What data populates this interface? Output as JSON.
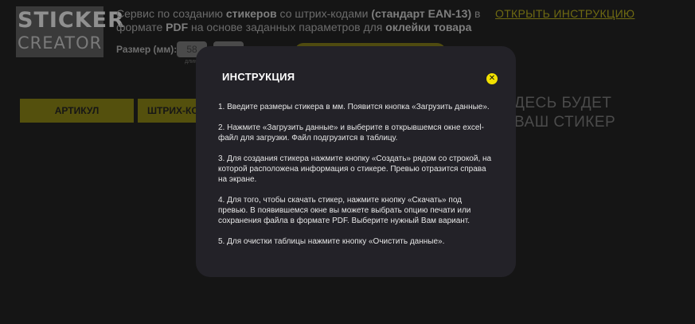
{
  "logo": {
    "line1": "STICKER",
    "line2": "CREATOR"
  },
  "header": {
    "tagline_parts": [
      {
        "text": "Сервис по созданию ",
        "bold": false
      },
      {
        "text": "стикеров",
        "bold": true
      },
      {
        "text": " со штрих-кодами ",
        "bold": false
      },
      {
        "text": "(стандарт EAN-13)",
        "bold": true
      },
      {
        "text": " в формате ",
        "bold": false
      },
      {
        "text": "PDF",
        "bold": true
      },
      {
        "text": " на основе заданных параметров для ",
        "bold": false
      },
      {
        "text": "оклейки товара",
        "bold": true
      }
    ],
    "instruction_link": "ОТКРЫТЬ ИНСТРУКЦИЮ"
  },
  "size": {
    "label": "Размер (мм):",
    "width_value": "58",
    "height_value": "",
    "hint": "длина"
  },
  "tabs": [
    {
      "label": "АРТИКУЛ"
    },
    {
      "label": "ШТРИХ-КО"
    }
  ],
  "preview": {
    "placeholder_line1": "ДЕСЬ БУДЕТ",
    "placeholder_line2": "ВАШ СТИКЕР"
  },
  "modal": {
    "title": "ИНСТРУКЦИЯ",
    "close_glyph": "✕",
    "steps": [
      "1. Введите размеры стикера в мм. Появится кнопка «Загрузить данные».",
      "2. Нажмите «Загрузить данные» и выберите в открывшемся окне excel-файл для загрузки. Файл подгрузится в таблицу.",
      "3. Для создания стикера нажмите кнопку «Создать» рядом со строкой, на которой расположена информация о стикере. Превью отразится справа на экране.",
      "4. Для того, чтобы скачать стикер, нажмите кнопку «Скачать» под превью. В появившемся окне вы можете выбрать опцию печати или сохранения файла в формате PDF. Выберите нужный Вам вариант.",
      "5. Для очистки таблицы нажмите кнопку «Очистить данные»."
    ]
  },
  "colors": {
    "accent": "#f2e100",
    "modal_bg": "#232228",
    "page_bg": "#151515"
  }
}
